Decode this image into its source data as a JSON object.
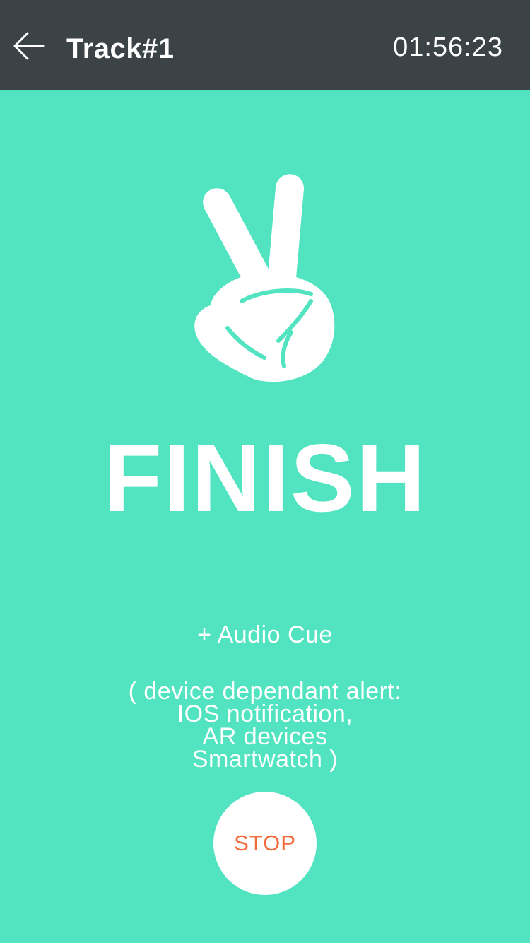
{
  "header": {
    "back_icon": "arrow-left-icon",
    "title": "Track#1",
    "timer": "01:56:23"
  },
  "main": {
    "hand_icon": "peace-hand-icon",
    "heading": "FINISH",
    "audio_cue": "+ Audio Cue",
    "alert_lines": [
      "( device dependant alert:",
      "IOS notification,",
      "AR devices",
      "Smartwatch )"
    ],
    "stop_label": "STOP"
  },
  "colors": {
    "background": "#52e3c1",
    "header": "#3c4346",
    "stop_text": "#f06a3a"
  }
}
